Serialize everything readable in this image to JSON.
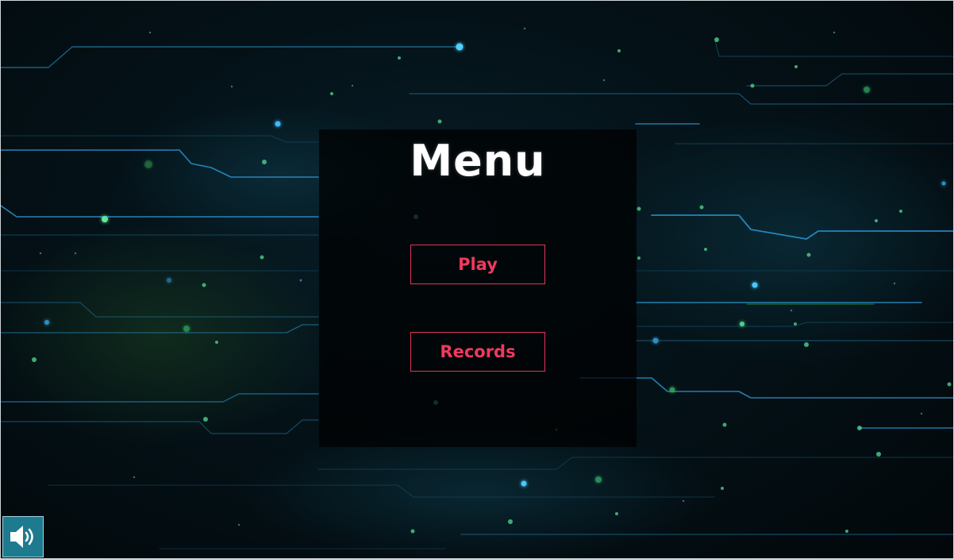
{
  "menu": {
    "title": "Menu",
    "buttons": [
      {
        "label": "Play"
      },
      {
        "label": "Records"
      }
    ]
  },
  "sound": {
    "icon": "speaker-volume-icon",
    "state": "on"
  },
  "colors": {
    "button_text": "#ee3a5e",
    "button_border": "#e0355a",
    "title_text": "#ffffff",
    "sound_button_bg": "#1e7a8e",
    "background": "#041218",
    "circuit_blue": "#1f8fc4",
    "circuit_green": "#46b83a"
  }
}
